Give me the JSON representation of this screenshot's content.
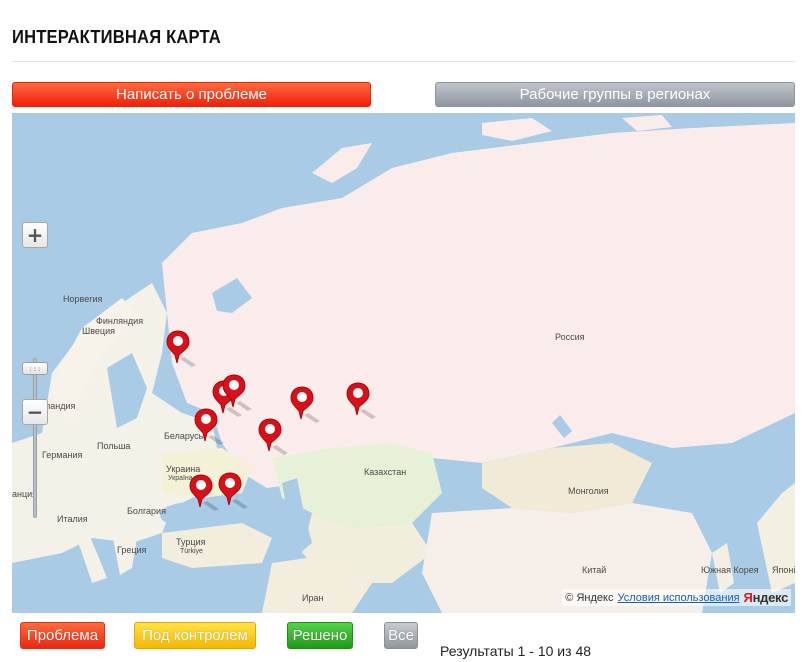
{
  "page": {
    "title": "ИНТЕРАКТИВНАЯ КАРТА"
  },
  "actions": {
    "report_problem": "Написать о проблеме",
    "regional_groups": "Рабочие группы в регионах"
  },
  "map": {
    "labels": {
      "russia": "Россия",
      "norway": "Норвегия",
      "finland": "Финляндия",
      "sweden": "Швеция",
      "landia": "ландия",
      "belarus": "Беларусь",
      "poland": "Польша",
      "germany": "Германия",
      "ukraine": "Украина",
      "ukraine_sub": "Украïна",
      "francia": "анция",
      "italy": "Италия",
      "bulgaria": "Болгария",
      "greece": "Греция",
      "turkey": "Турция",
      "turkey_sub": "Türkiye",
      "kazakhstan": "Казахстан",
      "mongolia": "Монголия",
      "iran": "Иран",
      "china": "Китай",
      "south_korea": "Южная Корея",
      "japan": "Японі"
    },
    "zoom": {
      "in_icon": "+",
      "out_icon": "−",
      "handle_glyph": ":::"
    },
    "marker_count": 9,
    "copyright": {
      "text": "© Яндекс",
      "terms": "Условия использования",
      "logo_first": "Я",
      "logo_rest": "ндекс"
    }
  },
  "filters": {
    "problem": "Проблема",
    "control": "Под контролем",
    "solved": "Решено",
    "all": "Все"
  },
  "results": {
    "text": "Результаты 1 - 10 из 48"
  },
  "colors": {
    "primary_red": "#f0200a",
    "gray_button": "#8e969f",
    "control_yellow": "#f5b700",
    "solved_green": "#229a18",
    "marker_red": "#d8101a",
    "water": "#a9cbe6",
    "russia_land": "#fbecec"
  }
}
